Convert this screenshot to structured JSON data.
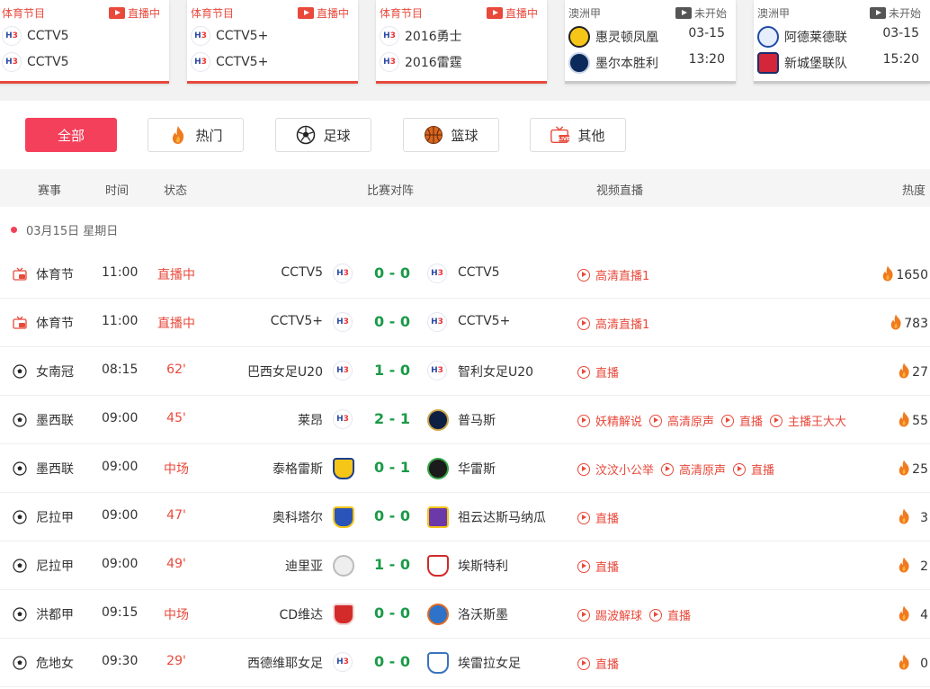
{
  "top_cards": [
    {
      "league": "体育节目",
      "status": "直播中",
      "style": "red",
      "rows": [
        {
          "name": "CCTV5",
          "val": ""
        },
        {
          "name": "CCTV5",
          "val": ""
        }
      ]
    },
    {
      "league": "体育节目",
      "status": "直播中",
      "style": "red",
      "rows": [
        {
          "name": "CCTV5+",
          "val": ""
        },
        {
          "name": "CCTV5+",
          "val": ""
        }
      ]
    },
    {
      "league": "体育节目",
      "status": "直播中",
      "style": "red",
      "rows": [
        {
          "name": "2016勇士",
          "val": ""
        },
        {
          "name": "2016雷霆",
          "val": ""
        }
      ]
    },
    {
      "league": "澳洲甲",
      "status": "未开始",
      "style": "gray",
      "rows": [
        {
          "name": "惠灵顿凤凰",
          "val": "03-15"
        },
        {
          "name": "墨尔本胜利",
          "val": "13:20"
        }
      ]
    },
    {
      "league": "澳洲甲",
      "status": "未开始",
      "style": "gray",
      "rows": [
        {
          "name": "阿德莱德联",
          "val": "03-15"
        },
        {
          "name": "新城堡联队",
          "val": "15:20"
        }
      ]
    }
  ],
  "tabs": [
    "全部",
    "热门",
    "足球",
    "篮球",
    "其他"
  ],
  "headers": {
    "league": "赛事",
    "time": "时间",
    "status": "状态",
    "match": "比赛对阵",
    "video": "视频直播",
    "heat": "热度"
  },
  "date_label": "03月15日 星期日",
  "matches": [
    {
      "type": "tv",
      "league": "体育节",
      "time": "11:00",
      "status": "直播中",
      "home": "CCTV5",
      "score": "0 - 0",
      "away": "CCTV5",
      "links": [
        "高清直播1"
      ],
      "heat": "1650"
    },
    {
      "type": "tv",
      "league": "体育节",
      "time": "11:00",
      "status": "直播中",
      "home": "CCTV5+",
      "score": "0 - 0",
      "away": "CCTV5+",
      "links": [
        "高清直播1"
      ],
      "heat": "783"
    },
    {
      "type": "ball",
      "league": "女南冠",
      "time": "08:15",
      "status": "62'",
      "home": "巴西女足U20",
      "score": "1 - 0",
      "away": "智利女足U20",
      "links": [
        "直播"
      ],
      "heat": "27"
    },
    {
      "type": "ball",
      "league": "墨西联",
      "time": "09:00",
      "status": "45'",
      "home": "莱昂",
      "score": "2 - 1",
      "away": "普马斯",
      "links": [
        "妖精解说",
        "高清原声",
        "直播",
        "主播王大大"
      ],
      "heat": "55"
    },
    {
      "type": "ball",
      "league": "墨西联",
      "time": "09:00",
      "status": "中场",
      "home": "泰格雷斯",
      "score": "0 - 1",
      "away": "华雷斯",
      "links": [
        "汶汶小公举",
        "高清原声",
        "直播"
      ],
      "heat": "25"
    },
    {
      "type": "ball",
      "league": "尼拉甲",
      "time": "09:00",
      "status": "47'",
      "home": "奥科塔尔",
      "score": "0 - 0",
      "away": "祖云达斯马纳瓜",
      "links": [
        "直播"
      ],
      "heat": "3"
    },
    {
      "type": "ball",
      "league": "尼拉甲",
      "time": "09:00",
      "status": "49'",
      "home": "迪里亚",
      "score": "1 - 0",
      "away": "埃斯特利",
      "links": [
        "直播"
      ],
      "heat": "2"
    },
    {
      "type": "ball",
      "league": "洪都甲",
      "time": "09:15",
      "status": "中场",
      "home": "CD维达",
      "score": "0 - 0",
      "away": "洛沃斯墨",
      "links": [
        "踢波解球",
        "直播"
      ],
      "heat": "4"
    },
    {
      "type": "ball",
      "league": "危地女",
      "time": "09:30",
      "status": "29'",
      "home": "西德维耶女足",
      "score": "0 - 0",
      "away": "埃雷拉女足",
      "links": [
        "直播"
      ],
      "heat": "0"
    }
  ],
  "colors": {
    "accent": "#f4405a",
    "live_red": "#e8493b",
    "score_green": "#1a9a47"
  }
}
